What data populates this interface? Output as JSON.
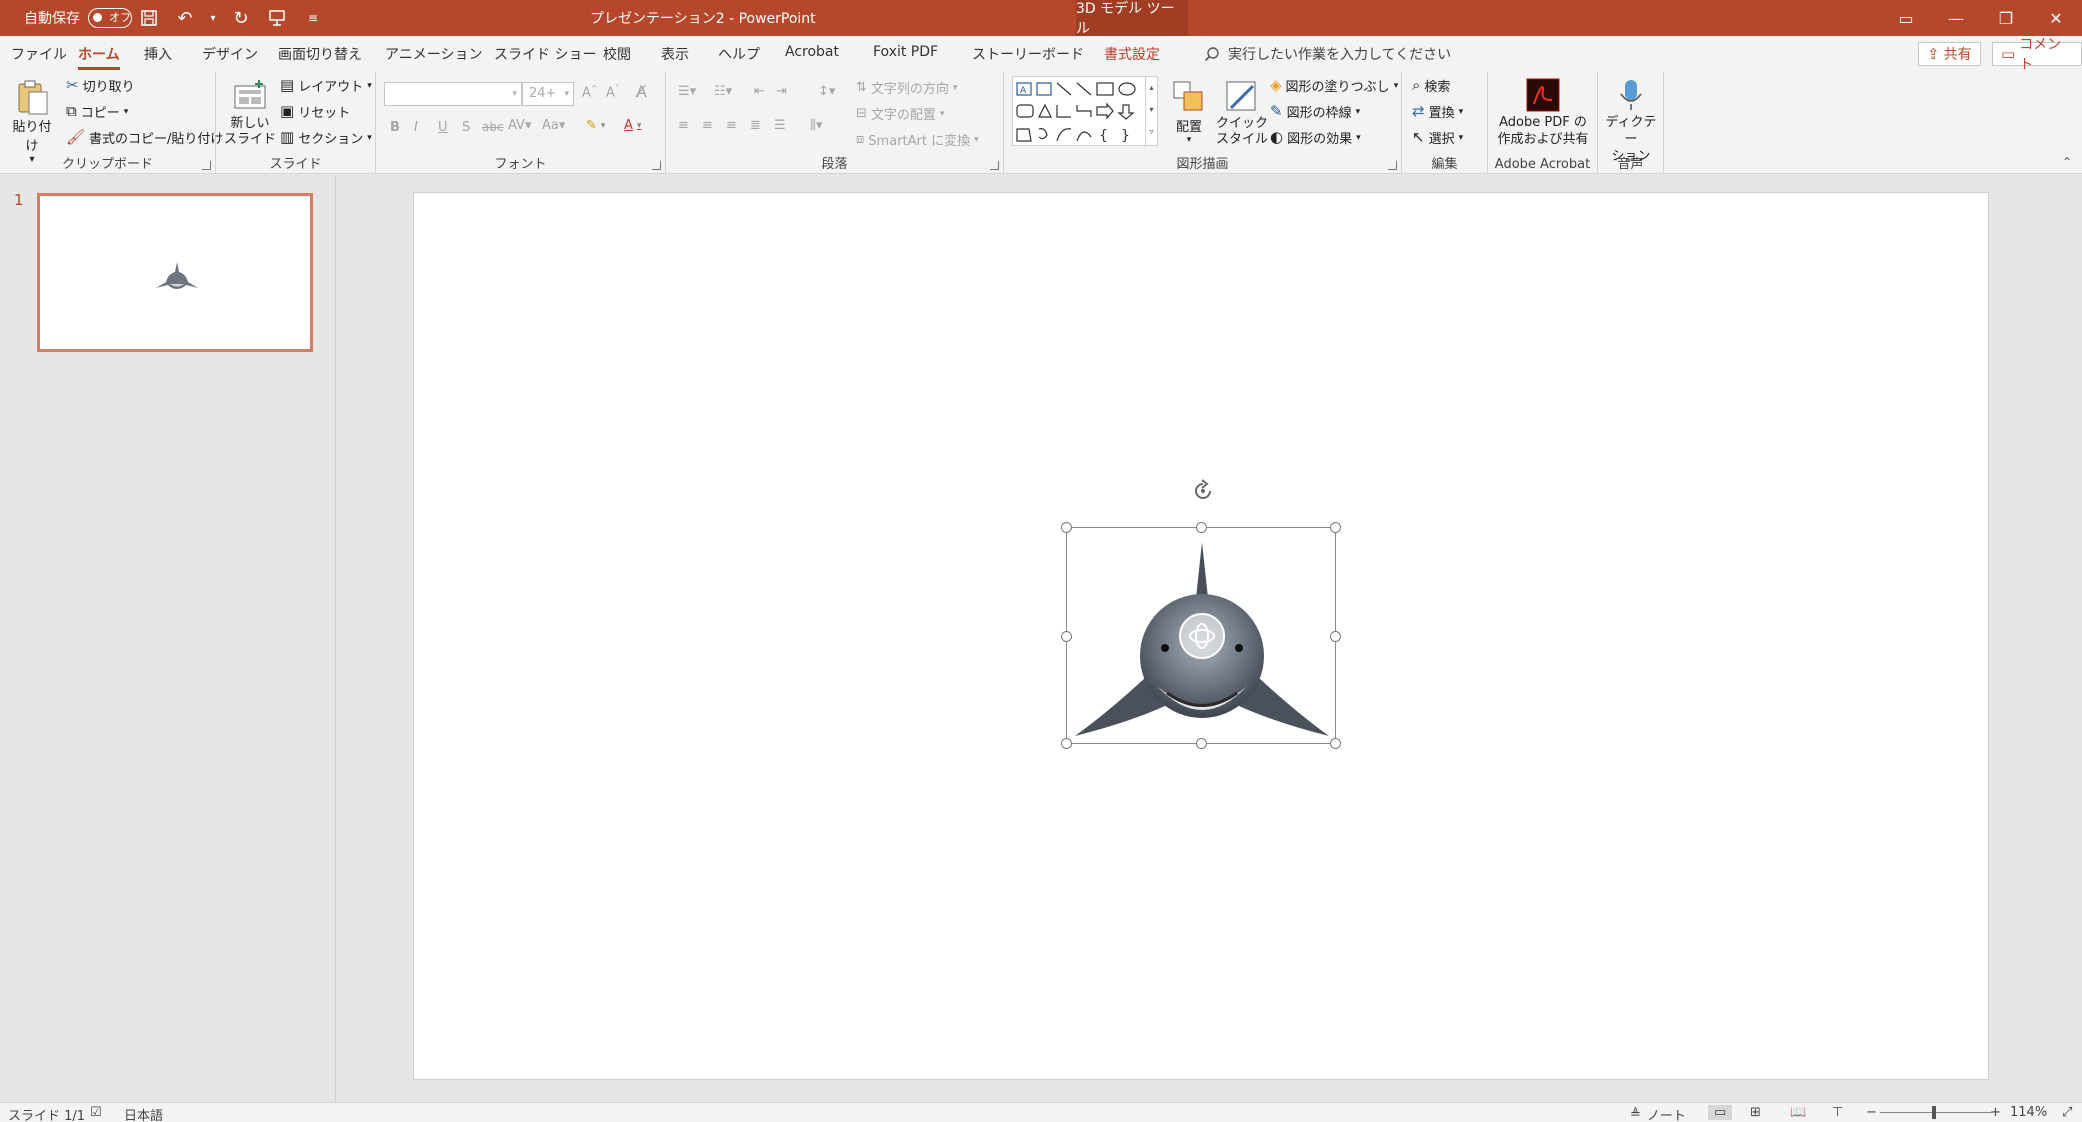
{
  "titlebar": {
    "autosave_label": "自動保存",
    "autosave_state": "オフ",
    "doc_title": "プレゼンテーション2  -  PowerPoint",
    "context_tool": "3D モデル ツール"
  },
  "tabs": [
    {
      "label": "ファイル"
    },
    {
      "label": "ホーム"
    },
    {
      "label": "挿入"
    },
    {
      "label": "デザイン"
    },
    {
      "label": "画面切り替え"
    },
    {
      "label": "アニメーション"
    },
    {
      "label": "スライド ショー"
    },
    {
      "label": "校閲"
    },
    {
      "label": "表示"
    },
    {
      "label": "ヘルプ"
    },
    {
      "label": "Acrobat"
    },
    {
      "label": "Foxit PDF"
    },
    {
      "label": "ストーリーボード"
    },
    {
      "label": "書式設定"
    }
  ],
  "tellme": "実行したい作業を入力してください",
  "share_label": "共有",
  "comment_label": "コメント",
  "ribbon": {
    "clipboard": {
      "paste": "貼り付け",
      "cut": "切り取り",
      "copy": "コピー",
      "format_painter": "書式のコピー/貼り付け",
      "group": "クリップボード"
    },
    "slides": {
      "new_slide_1": "新しい",
      "new_slide_2": "スライド",
      "layout": "レイアウト",
      "reset": "リセット",
      "section": "セクション",
      "group": "スライド"
    },
    "font": {
      "size": "24+",
      "bold": "B",
      "italic": "I",
      "underline": "U",
      "shadow": "S",
      "strike": "abc",
      "group": "フォント"
    },
    "paragraph": {
      "text_direction": "文字列の方向",
      "align_text": "文字の配置",
      "smartart": "SmartArt に変換",
      "group": "段落"
    },
    "drawing": {
      "arrange": "配置",
      "quick_style_1": "クイック",
      "quick_style_2": "スタイル",
      "fill": "図形の塗りつぶし",
      "outline": "図形の枠線",
      "effects": "図形の効果",
      "group": "図形描画"
    },
    "editing": {
      "find": "検索",
      "replace": "置換",
      "select": "選択",
      "group": "編集"
    },
    "acrobat": {
      "pdf_1": "Adobe PDF の",
      "pdf_2": "作成および共有",
      "group": "Adobe Acrobat"
    },
    "voice": {
      "dictate_1": "ディクテー",
      "dictate_2": "ション",
      "group": "音声"
    }
  },
  "thumbnails": [
    {
      "number": "1"
    }
  ],
  "statusbar": {
    "slide_info": "スライド 1/1",
    "language": "日本語",
    "notes": "ノート",
    "zoom": "114%"
  },
  "colors": {
    "accent": "#b7472a",
    "thumb_border": "#e07a5f"
  }
}
